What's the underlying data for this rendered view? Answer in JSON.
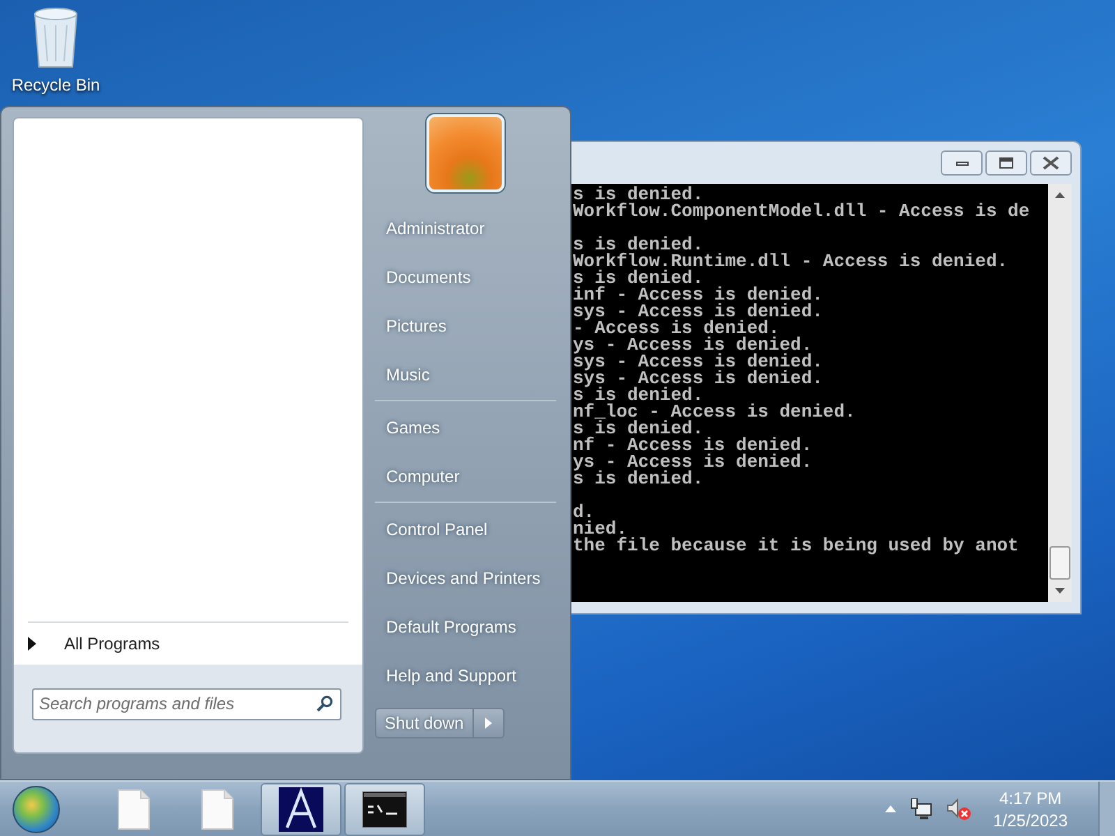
{
  "desktop_icons": [
    {
      "label": "Recycle Bin"
    }
  ],
  "console": {
    "paragraphs": [
      [
        "s is denied.",
        "Workflow.ComponentModel.dll - Access is de"
      ],
      [
        "s is denied.",
        "Workflow.Runtime.dll - Access is denied.",
        "s is denied.",
        "inf - Access is denied.",
        "sys - Access is denied.",
        "- Access is denied.",
        "ys - Access is denied.",
        "sys - Access is denied.",
        "sys - Access is denied.",
        "s is denied.",
        "nf_loc - Access is denied.",
        "s is denied.",
        "nf - Access is denied.",
        "ys - Access is denied.",
        "s is denied."
      ],
      [
        "d.",
        "nied.",
        "the file because it is being used by anot"
      ]
    ]
  },
  "start_menu": {
    "all_programs": "All Programs",
    "search": {
      "placeholder": "Search programs and files"
    },
    "right_items": [
      {
        "kind": "item",
        "label": "Administrator"
      },
      {
        "kind": "item",
        "label": "Documents"
      },
      {
        "kind": "item",
        "label": "Pictures"
      },
      {
        "kind": "item",
        "label": "Music"
      },
      {
        "kind": "separator"
      },
      {
        "kind": "item",
        "label": "Games"
      },
      {
        "kind": "item",
        "label": "Computer"
      },
      {
        "kind": "separator"
      },
      {
        "kind": "item",
        "label": "Control Panel"
      },
      {
        "kind": "item",
        "label": "Devices and Printers"
      },
      {
        "kind": "item",
        "label": "Default Programs"
      },
      {
        "kind": "item",
        "label": "Help and Support"
      }
    ],
    "shut_down": "Shut down"
  },
  "taskbar": {
    "buttons": [
      {
        "kind": "document",
        "running": false
      },
      {
        "kind": "document",
        "running": false
      },
      {
        "kind": "letter-app",
        "running": true
      },
      {
        "kind": "console",
        "running": true
      }
    ],
    "clock": {
      "time": "4:17 PM",
      "date": "1/25/2023"
    }
  }
}
